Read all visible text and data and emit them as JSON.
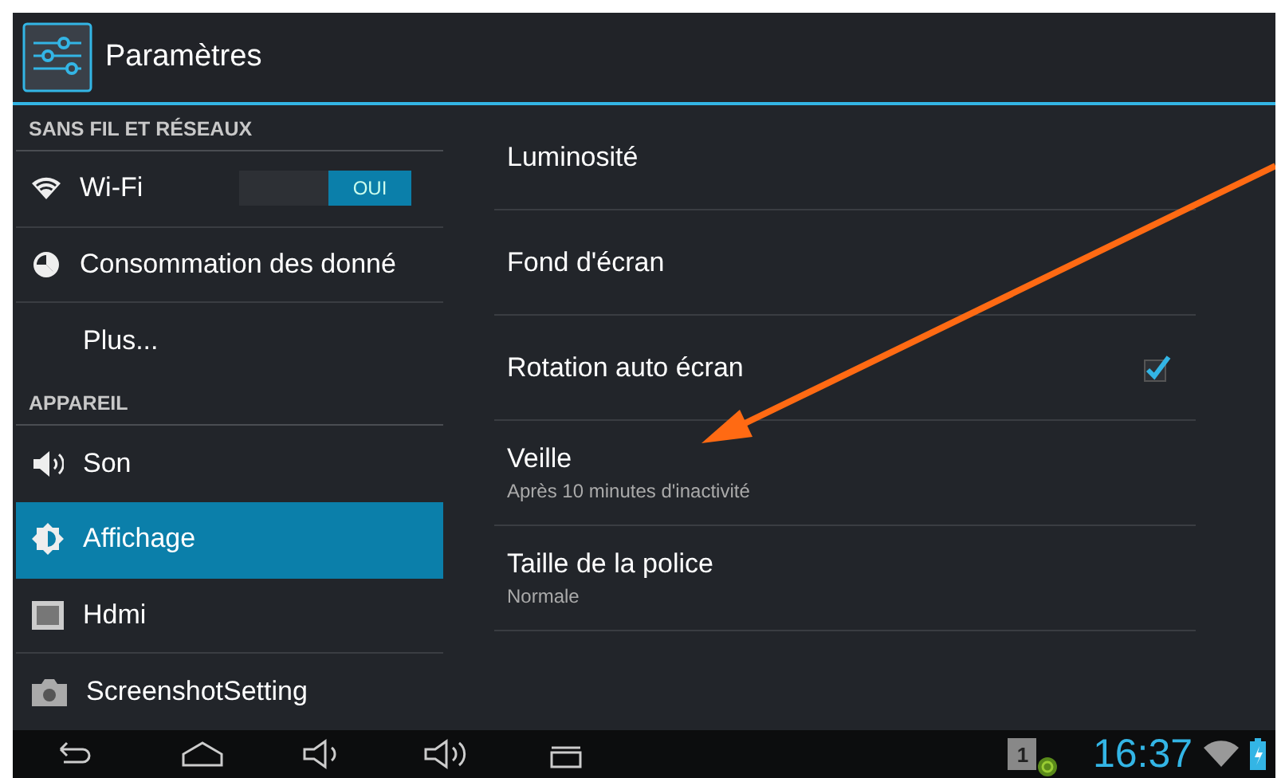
{
  "action_bar": {
    "title": "Paramètres"
  },
  "sidebar": {
    "sections": [
      {
        "header": "SANS FIL ET RÉSEAUX",
        "items": [
          {
            "label": "Wi-Fi",
            "kind": "wifi",
            "selected": false,
            "toggle": {
              "label": "OUI",
              "on": true
            }
          },
          {
            "label": "Consommation des donné",
            "kind": "data",
            "selected": false
          },
          {
            "label": "Plus...",
            "kind": "plain",
            "selected": false
          }
        ]
      },
      {
        "header": "APPAREIL",
        "items": [
          {
            "label": "Son",
            "kind": "sound",
            "selected": false
          },
          {
            "label": "Affichage",
            "kind": "display",
            "selected": true
          },
          {
            "label": "Hdmi",
            "kind": "hdmi",
            "selected": false
          },
          {
            "label": "ScreenshotSetting",
            "kind": "camera",
            "selected": false
          }
        ]
      }
    ]
  },
  "settings": [
    {
      "title": "Luminosité",
      "kind": "plain"
    },
    {
      "title": "Fond d'écran",
      "kind": "plain"
    },
    {
      "title": "Rotation auto écran",
      "kind": "checkbox",
      "checked": true
    },
    {
      "title": "Veille",
      "kind": "summary",
      "summary": "Après 10 minutes d'inactivité"
    },
    {
      "title": "Taille de la police",
      "kind": "summary",
      "summary": "Normale"
    }
  ],
  "status_bar": {
    "notification": "1",
    "time": "16:37"
  }
}
